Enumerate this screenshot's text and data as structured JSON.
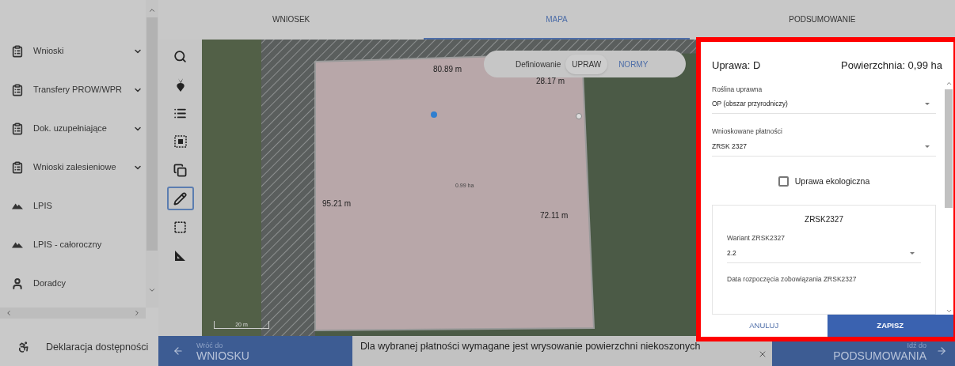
{
  "sidebar": {
    "items": [
      {
        "label": "Wnioski",
        "kind": "document",
        "expandable": true
      },
      {
        "label": "Transfery PROW/WPR",
        "kind": "document",
        "expandable": true
      },
      {
        "label": "Dok. uzupełniające",
        "kind": "document",
        "expandable": true
      },
      {
        "label": "Wnioski zalesieniowe",
        "kind": "document",
        "expandable": true
      },
      {
        "label": "LPIS",
        "kind": "land",
        "expandable": false
      },
      {
        "label": "LPIS - całoroczny",
        "kind": "land",
        "expandable": false
      },
      {
        "label": "Doradcy",
        "kind": "people",
        "expandable": false
      }
    ],
    "footer_item": {
      "label": "Deklaracja dostępności"
    }
  },
  "tabs": [
    {
      "label": "WNIOSEK",
      "selected": false
    },
    {
      "label": "MAPA",
      "selected": true
    },
    {
      "label": "PODSUMOWANIE",
      "selected": false
    }
  ],
  "tools": [
    {
      "kind": "search",
      "selected": false
    },
    {
      "kind": "beet",
      "selected": false
    },
    {
      "kind": "list",
      "selected": false
    },
    {
      "kind": "select",
      "selected": false
    },
    {
      "kind": "copy",
      "selected": false
    },
    {
      "kind": "pencil",
      "selected": true
    },
    {
      "kind": "rectangle",
      "selected": false
    },
    {
      "kind": "ruler",
      "selected": false
    }
  ],
  "map": {
    "toggle_label": "Definiowanie",
    "options": [
      {
        "label": "UPRAW",
        "selected": true
      },
      {
        "label": "NORMY",
        "selected": false
      }
    ],
    "measurements": [
      "80.89 m",
      "28.17 m",
      "95.21 m",
      "72.11 m"
    ],
    "area_label": "0.99 ha",
    "scale_label": "20 m"
  },
  "panel": {
    "title": "Uprawa: D",
    "area": "Powierzchnia: 0,99 ha",
    "fields": [
      {
        "label": "Roślina uprawna",
        "value": "OP (obszar przyrodniczy)"
      },
      {
        "label": "Wnioskowane płatności",
        "value": "ZRSK 2327"
      }
    ],
    "checkbox": {
      "label": "Uprawa ekologiczna",
      "checked": false
    },
    "section": {
      "title": "ZRSK2327",
      "fields": [
        {
          "label": "Wariant ZRSK2327",
          "value": "2.2"
        }
      ],
      "next_label": "Data rozpoczęcia zobowiązania ZRSK2327"
    },
    "cancel": "ANULUJ",
    "save": "ZAPISZ"
  },
  "bottom": {
    "back": {
      "small": "Wróć do",
      "big": "WNIOSKU"
    },
    "toast": "Dla wybranej płatności wymagane jest wrysowanie powierzchni niekoszonych",
    "forward": {
      "small": "Idź do",
      "big": "PODSUMOWANIA"
    }
  }
}
